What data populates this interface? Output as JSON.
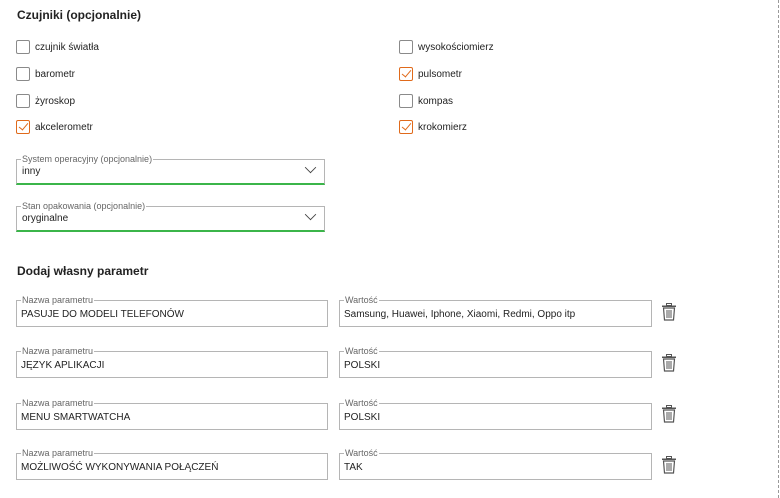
{
  "sensors": {
    "title": "Czujniki (opcjonalnie)",
    "left": [
      {
        "label": "czujnik światła",
        "checked": false
      },
      {
        "label": "barometr",
        "checked": false
      },
      {
        "label": "żyroskop",
        "checked": false
      },
      {
        "label": "akcelerometr",
        "checked": true
      }
    ],
    "right": [
      {
        "label": "wysokościomierz",
        "checked": false
      },
      {
        "label": "pulsometr",
        "checked": true
      },
      {
        "label": "kompas",
        "checked": false
      },
      {
        "label": "krokomierz",
        "checked": true
      }
    ]
  },
  "os_select": {
    "label": "System operacyjny (opcjonalnie)",
    "value": "inny"
  },
  "packaging_select": {
    "label": "Stan opakowania (opcjonalnie)",
    "value": "oryginalne"
  },
  "custom_params": {
    "title": "Dodaj własny parametr",
    "name_label": "Nazwa parametru",
    "value_label": "Wartość",
    "rows": [
      {
        "name": "PASUJE DO MODELI TELEFONÓW",
        "value": "Samsung, Huawei, Iphone, Xiaomi, Redmi, Oppo itp"
      },
      {
        "name": "JĘZYK APLIKACJI",
        "value": "POLSKI"
      },
      {
        "name": "MENU SMARTWATCHA",
        "value": "POLSKI"
      },
      {
        "name": "MOŻLIWOŚĆ WYKONYWANIA POŁĄCZEŃ",
        "value": "TAK"
      }
    ]
  },
  "colors": {
    "accent_check": "#e06a1b",
    "select_underline": "#3bb54a"
  },
  "icons": {
    "delete": "trash-icon",
    "dropdown": "chevron-down-icon"
  }
}
